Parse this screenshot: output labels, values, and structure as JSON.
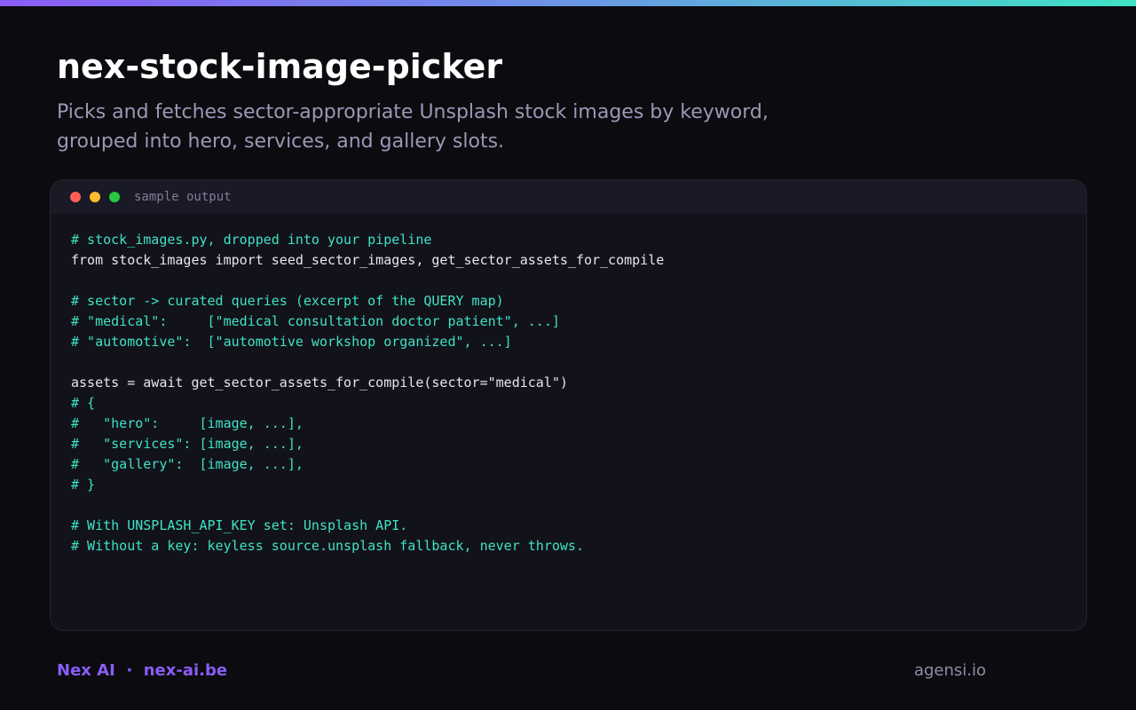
{
  "header": {
    "title": "nex-stock-image-picker",
    "subtitle": "Picks and fetches sector-appropriate Unsplash stock images by keyword, grouped into hero, services, and gallery slots."
  },
  "terminal": {
    "label": "sample output",
    "lines": [
      {
        "type": "comment",
        "text": "# stock_images.py, dropped into your pipeline"
      },
      {
        "type": "plain",
        "text": "from stock_images import seed_sector_images, get_sector_assets_for_compile"
      },
      {
        "type": "blank",
        "text": ""
      },
      {
        "type": "comment",
        "text": "# sector -> curated queries (excerpt of the QUERY map)"
      },
      {
        "type": "comment",
        "text": "# \"medical\":     [\"medical consultation doctor patient\", ...]"
      },
      {
        "type": "comment",
        "text": "# \"automotive\":  [\"automotive workshop organized\", ...]"
      },
      {
        "type": "blank",
        "text": ""
      },
      {
        "type": "plain",
        "text": "assets = await get_sector_assets_for_compile(sector=\"medical\")"
      },
      {
        "type": "comment",
        "text": "# {"
      },
      {
        "type": "comment",
        "text": "#   \"hero\":     [image, ...],"
      },
      {
        "type": "comment",
        "text": "#   \"services\": [image, ...],"
      },
      {
        "type": "comment",
        "text": "#   \"gallery\":  [image, ...],"
      },
      {
        "type": "comment",
        "text": "# }"
      },
      {
        "type": "blank",
        "text": ""
      },
      {
        "type": "comment",
        "text": "# With UNSPLASH_API_KEY set: Unsplash API."
      },
      {
        "type": "comment",
        "text": "# Without a key: keyless source.unsplash fallback, never throws."
      }
    ]
  },
  "footer": {
    "brand": "Nex AI",
    "separator": "·",
    "site": "nex-ai.be",
    "credit": "agensi.io"
  },
  "colors": {
    "accent_purple": "#8b5cf6",
    "accent_teal": "#3fe3c4",
    "background": "#0b0b10"
  }
}
